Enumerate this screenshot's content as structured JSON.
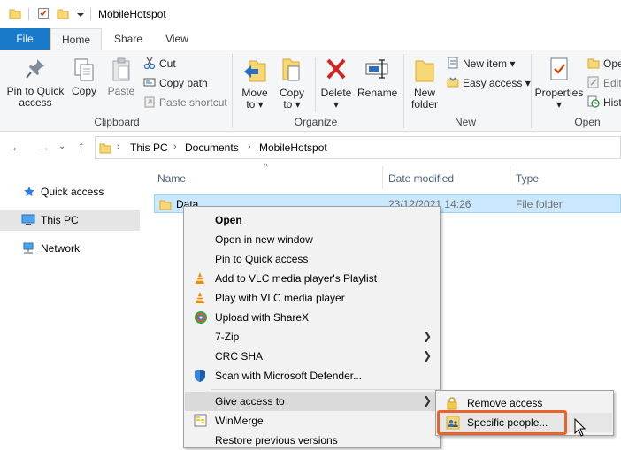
{
  "window": {
    "title": "MobileHotspot"
  },
  "tabs": {
    "file": "File",
    "home": "Home",
    "share": "Share",
    "view": "View"
  },
  "ribbon": {
    "clipboard": {
      "label": "Clipboard",
      "pin_line1": "Pin to Quick",
      "pin_line2": "access",
      "copy": "Copy",
      "paste": "Paste",
      "cut": "Cut",
      "copy_path": "Copy path",
      "paste_shortcut": "Paste shortcut"
    },
    "organize": {
      "label": "Organize",
      "move_to": "Move",
      "move_to2": "to",
      "copy_to": "Copy",
      "copy_to2": "to",
      "delete": "Delete",
      "rename": "Rename"
    },
    "new": {
      "label": "New",
      "new_folder1": "New",
      "new_folder2": "folder",
      "new_item": "New item",
      "easy_access": "Easy access"
    },
    "open": {
      "label": "Open",
      "properties": "Properties",
      "open": "Ope",
      "edit": "Edit",
      "history": "Hist"
    }
  },
  "address": {
    "crumbs": [
      "This PC",
      "Documents",
      "MobileHotspot"
    ]
  },
  "nav": {
    "quick_access": "Quick access",
    "this_pc": "This PC",
    "network": "Network"
  },
  "columns": {
    "name": "Name",
    "date": "Date modified",
    "type": "Type"
  },
  "files": [
    {
      "name": "Data",
      "date": "23/12/2021 14:26",
      "type": "File folder"
    }
  ],
  "context_menu": {
    "items": [
      "Open",
      "Open in new window",
      "Pin to Quick access",
      "Add to VLC media player's Playlist",
      "Play with VLC media player",
      "Upload with ShareX",
      "7-Zip",
      "CRC SHA",
      "Scan with Microsoft Defender...",
      "Give access to",
      "WinMerge",
      "Restore previous versions"
    ]
  },
  "submenu": {
    "items": [
      "Remove access",
      "Specific people..."
    ]
  },
  "colors": {
    "accent": "#1979ca",
    "selection": "#cce8ff",
    "highlight_border": "#e8642c"
  }
}
